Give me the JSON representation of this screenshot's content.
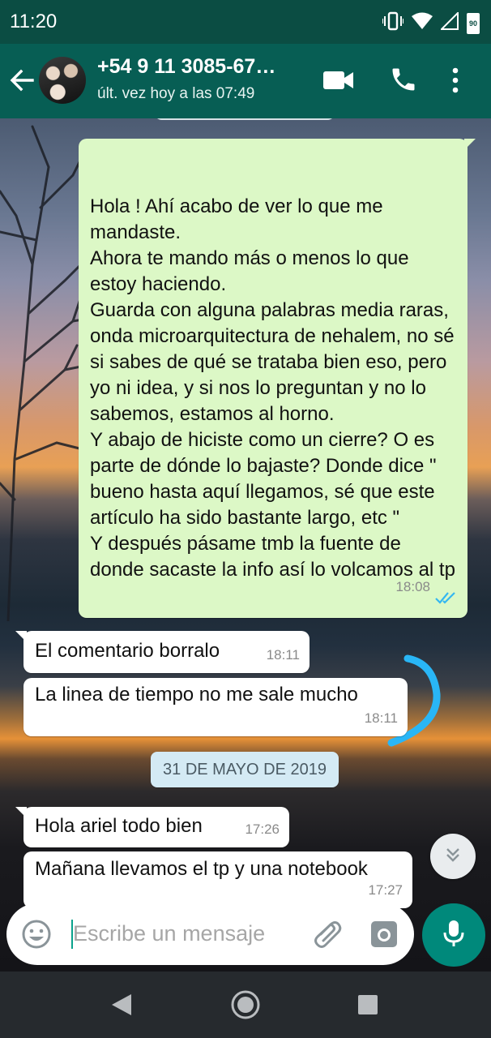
{
  "status_bar": {
    "time": "11:20",
    "battery_level": "90"
  },
  "header": {
    "contact_name": "+54 9 11 3085-67…",
    "last_seen": "últ. vez hoy a las 07:49"
  },
  "messages": [
    {
      "direction": "out",
      "text": "Hola ! Ahí acabo de ver lo que me mandaste.\nAhora te mando más o menos lo que estoy haciendo.\nGuarda con alguna palabras media raras, onda microarquitectura de nehalem, no sé si sabes de qué se trataba bien eso, pero yo ni idea, y si nos lo preguntan y no lo sabemos, estamos al horno.\nY abajo de hiciste como un cierre? O es parte de dónde lo bajaste? Donde dice \" bueno hasta aquí llegamos, sé que este artículo ha sido bastante largo, etc \"\nY después pásame tmb la fuente de donde sacaste la info así lo volcamos al tp",
      "time": "18:08",
      "ticks_color": "#34b7f1"
    },
    {
      "direction": "in",
      "text": "El comentario borralo",
      "time": "18:11"
    },
    {
      "direction": "in",
      "text": "La linea de tiempo no me sale mucho",
      "time": "18:11"
    },
    {
      "direction": "in",
      "text": "Hola ariel todo bien",
      "time": "17:26"
    },
    {
      "direction": "in",
      "text": "Mañana llevamos el tp y una notebook",
      "time": "17:27"
    }
  ],
  "date_separator": "31 DE MAYO DE 2019",
  "composer": {
    "placeholder": "Escribe un mensaje"
  },
  "colors": {
    "header": "#075e54",
    "status_bar": "#0b4d43",
    "outgoing_bubble": "#dcf8c6",
    "incoming_bubble": "#ffffff",
    "accent": "#00897b",
    "doodle": "#29b6f6"
  },
  "icons": [
    "back-arrow-icon",
    "video-call-icon",
    "phone-icon",
    "more-vert-icon",
    "emoji-icon",
    "paperclip-icon",
    "camera-icon",
    "mic-icon",
    "double-chevron-down-icon",
    "nav-back-icon",
    "nav-home-icon",
    "nav-recents-icon"
  ]
}
